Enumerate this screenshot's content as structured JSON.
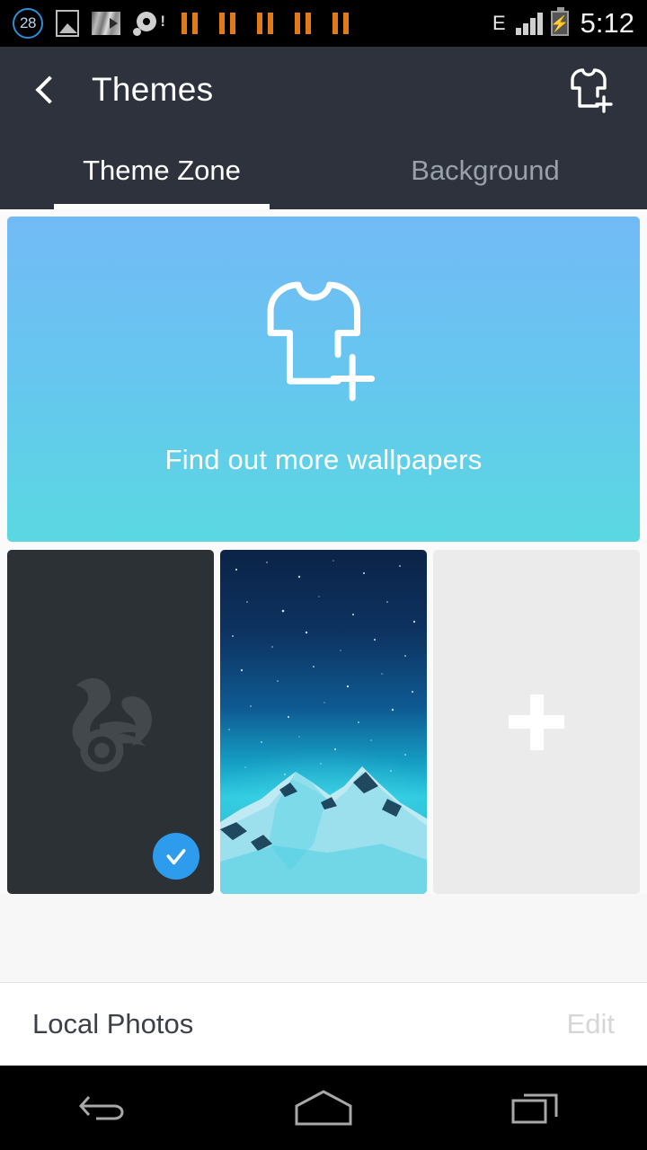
{
  "status_bar": {
    "notification_badge": "28",
    "icons": [
      "circle-badge-28",
      "photo-icon",
      "media-thumbnail-icon",
      "disc-warning-icon",
      "pause-icon",
      "pause-icon",
      "pause-icon",
      "pause-icon",
      "pause-icon"
    ],
    "network_type": "E",
    "signal": "signal-bars-icon",
    "battery": "battery-charging-icon",
    "time": "5:12"
  },
  "header": {
    "back_icon": "back-chevron-icon",
    "title": "Themes",
    "action_icon": "tshirt-add-icon"
  },
  "tabs": [
    {
      "label": "Theme Zone",
      "active": true
    },
    {
      "label": "Background",
      "active": false
    }
  ],
  "banner": {
    "icon": "tshirt-add-icon",
    "text": "Find out more wallpapers",
    "gradient_from": "#72baf6",
    "gradient_to": "#5ad8e1"
  },
  "thumbnails": [
    {
      "name": "default-theme-thumbnail",
      "kind": "dark-card",
      "watermark": "uc-browser-squirrel-logo",
      "selected": true,
      "badge": "check-icon",
      "badge_color": "#2d9cec",
      "background_color": "#2c3136"
    },
    {
      "name": "starry-mountain-wallpaper-thumbnail",
      "kind": "photo",
      "selected": false,
      "description": "starry night sky over snowy mountains"
    },
    {
      "name": "add-wallpaper-tile",
      "kind": "add-placeholder",
      "icon": "plus-icon",
      "selected": false,
      "background_color": "#ebebeb"
    }
  ],
  "bottom_bar": {
    "title": "Local Photos",
    "edit_label": "Edit"
  },
  "nav_bar": {
    "back": "nav-back-icon",
    "home": "nav-home-icon",
    "recents": "nav-recents-icon"
  }
}
